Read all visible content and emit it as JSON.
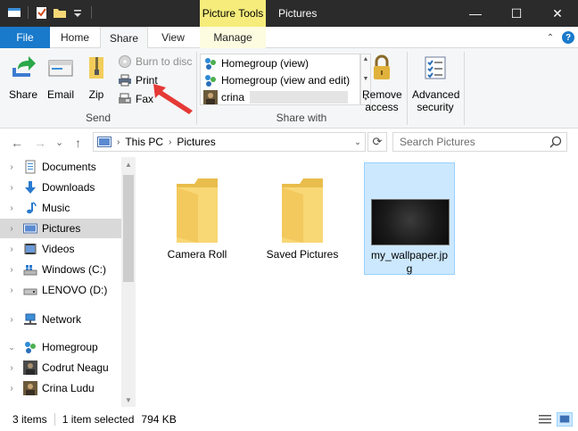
{
  "titlebar": {
    "context_tab_label": "Picture Tools",
    "window_title": "Pictures",
    "minimize": "—",
    "maximize": "☐",
    "close": "✕"
  },
  "tabs": {
    "file": "File",
    "home": "Home",
    "share": "Share",
    "view": "View",
    "manage": "Manage",
    "collapse": "⌃",
    "help": "?"
  },
  "ribbon": {
    "send": {
      "share": "Share",
      "email": "Email",
      "zip": "Zip",
      "burn": "Burn to disc",
      "print": "Print",
      "fax": "Fax",
      "group_label": "Send"
    },
    "share_with": {
      "items": [
        "Homegroup (view)",
        "Homegroup (view and edit)",
        "crina"
      ],
      "remove_access_line1": "Remove",
      "remove_access_line2": "access",
      "advanced_line1": "Advanced",
      "advanced_line2": "security",
      "group_label": "Share with"
    }
  },
  "address": {
    "back": "←",
    "forward": "→",
    "recent": "⌄",
    "up": "↑",
    "crumbs": [
      "This PC",
      "Pictures"
    ],
    "dropdown": "⌄",
    "refresh": "⟳",
    "search_placeholder": "Search Pictures"
  },
  "nav": {
    "items": [
      {
        "label": "Documents",
        "icon": "documents-icon"
      },
      {
        "label": "Downloads",
        "icon": "downloads-icon"
      },
      {
        "label": "Music",
        "icon": "music-icon"
      },
      {
        "label": "Pictures",
        "icon": "pictures-icon",
        "selected": true
      },
      {
        "label": "Videos",
        "icon": "videos-icon"
      },
      {
        "label": "Windows (C:)",
        "icon": "drive-icon"
      },
      {
        "label": "LENOVO (D:)",
        "icon": "drive-icon"
      },
      {
        "label": "Network",
        "icon": "network-icon"
      },
      {
        "label": "Homegroup",
        "icon": "homegroup-icon",
        "expanded": true
      },
      {
        "label": "Codrut Neagu",
        "icon": "user-avatar-icon"
      },
      {
        "label": "Crina Ludu",
        "icon": "user-avatar-icon"
      }
    ]
  },
  "content": {
    "items": [
      {
        "label": "Camera Roll",
        "type": "folder"
      },
      {
        "label": "Saved Pictures",
        "type": "folder"
      },
      {
        "label_line1": "my_wallpaper.jp",
        "label_line2": "g",
        "type": "image",
        "selected": true
      }
    ]
  },
  "status": {
    "items_count": "3 items",
    "selected": "1 item selected",
    "size": "794 KB"
  },
  "colors": {
    "accent": "#1979ca",
    "context_tab": "#f5ec7b",
    "selection": "#cce8ff",
    "arrow": "#e53935"
  }
}
